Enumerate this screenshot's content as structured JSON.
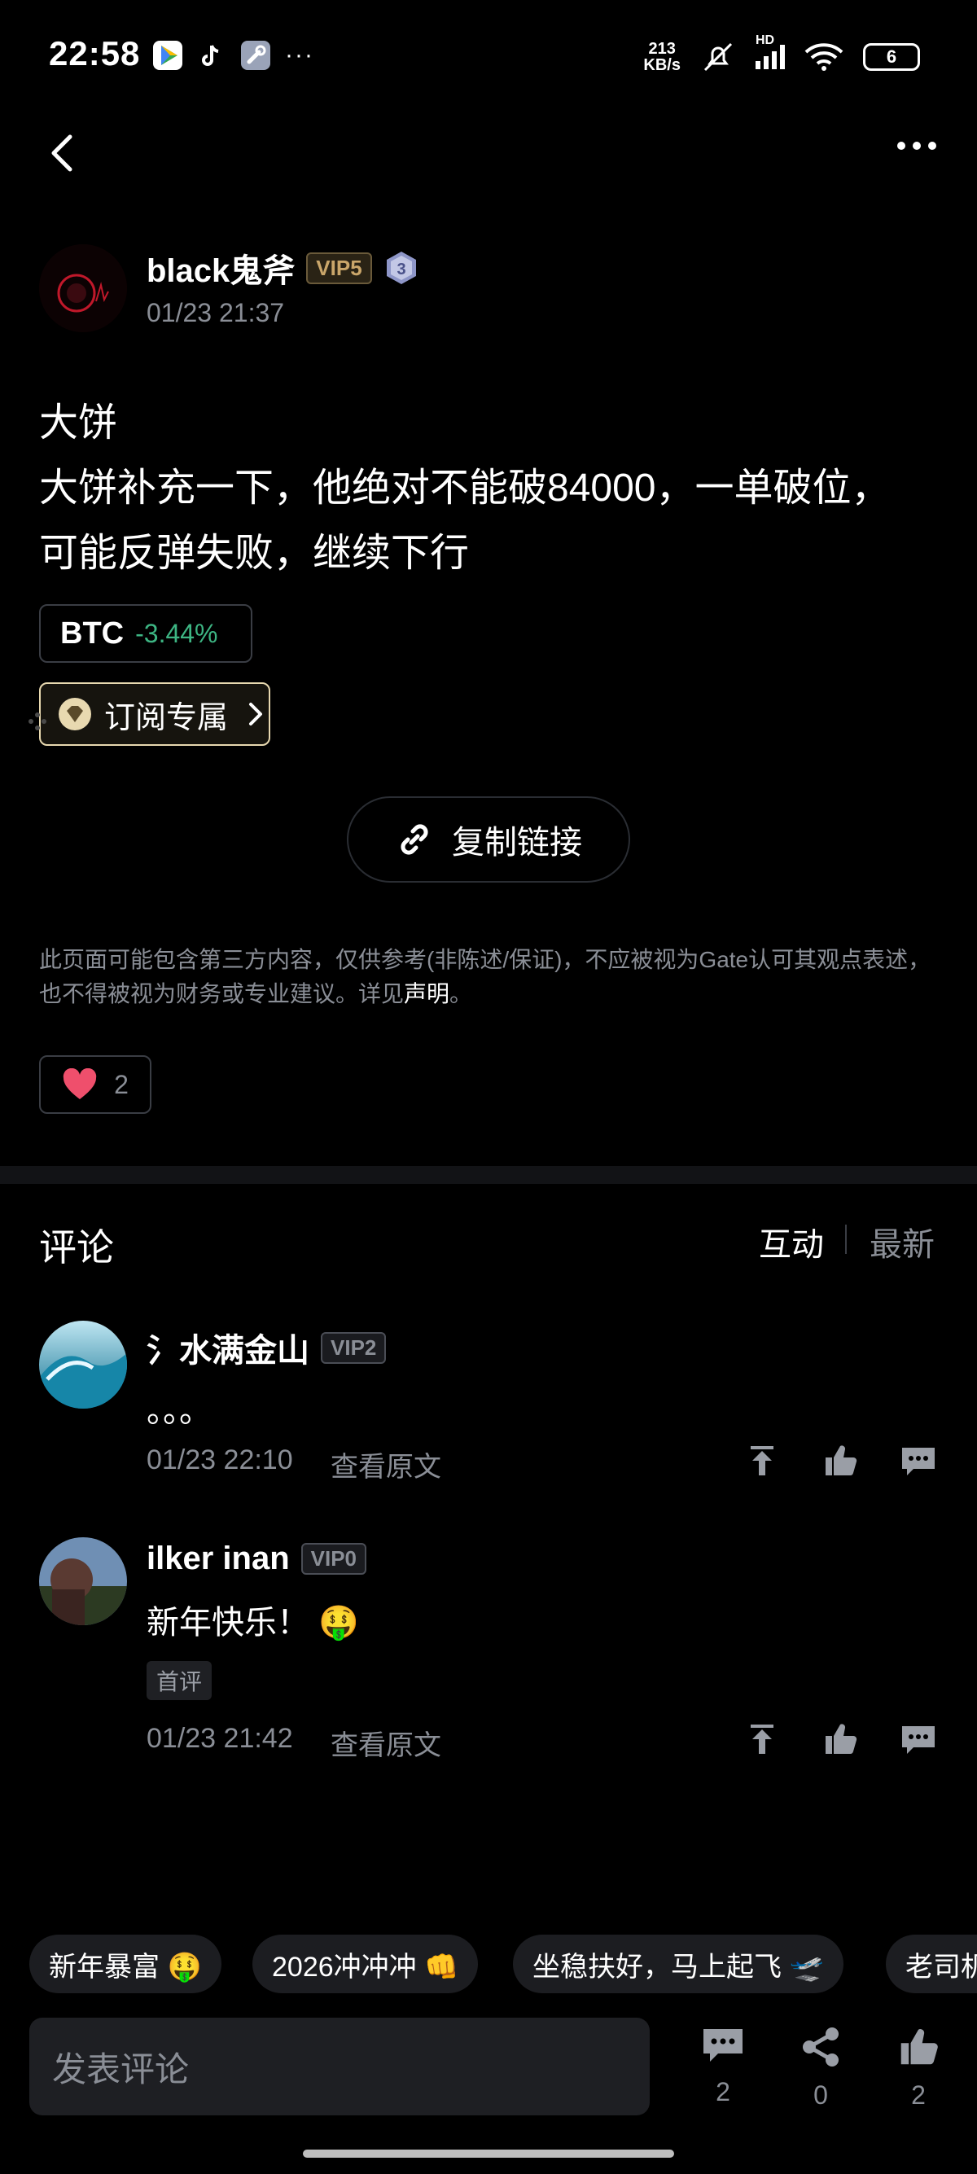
{
  "status": {
    "time": "22:58",
    "speed_top": "213",
    "speed_bottom": "KB/s",
    "battery": "6",
    "network": "HD"
  },
  "post": {
    "author": "black鬼斧",
    "vip": "VIP5",
    "level": "3",
    "time": "01/23 21:37",
    "lines": [
      "大饼",
      "大饼补充一下，他绝对不能破84000，一单破位，",
      "可能反弹失败，继续下行"
    ],
    "ticker_symbol": "BTC",
    "ticker_change": "-3.44%",
    "subscribe_label": "订阅专属",
    "copy_link_label": "复制链接",
    "disclaimer_text": "此页面可能包含第三方内容，仅供参考(非陈述/保证)，不应被视为Gate认可其观点表述，也不得被视为财务或专业建议。详见",
    "disclaimer_link": "声明",
    "disclaimer_end": "。",
    "likes": "2"
  },
  "comments_section": {
    "title": "评论",
    "sort_hot": "互动",
    "sort_new": "最新",
    "items": [
      {
        "name": "氵水满金山",
        "vip": "VIP2",
        "text": "。。。",
        "time": "01/23 22:10",
        "view_original": "查看原文",
        "tag": ""
      },
      {
        "name": "ilker inan",
        "vip": "VIP0",
        "text": "新年快乐！ 🤑",
        "time": "01/23 21:42",
        "view_original": "查看原文",
        "tag": "首评"
      }
    ]
  },
  "chips": [
    "新年暴富 🤑",
    "2026冲冲冲 👊",
    "坐稳扶好，马上起飞 🛫",
    "老司机"
  ],
  "bottom": {
    "placeholder": "发表评论",
    "comments": "2",
    "shares": "0",
    "likes": "2"
  }
}
